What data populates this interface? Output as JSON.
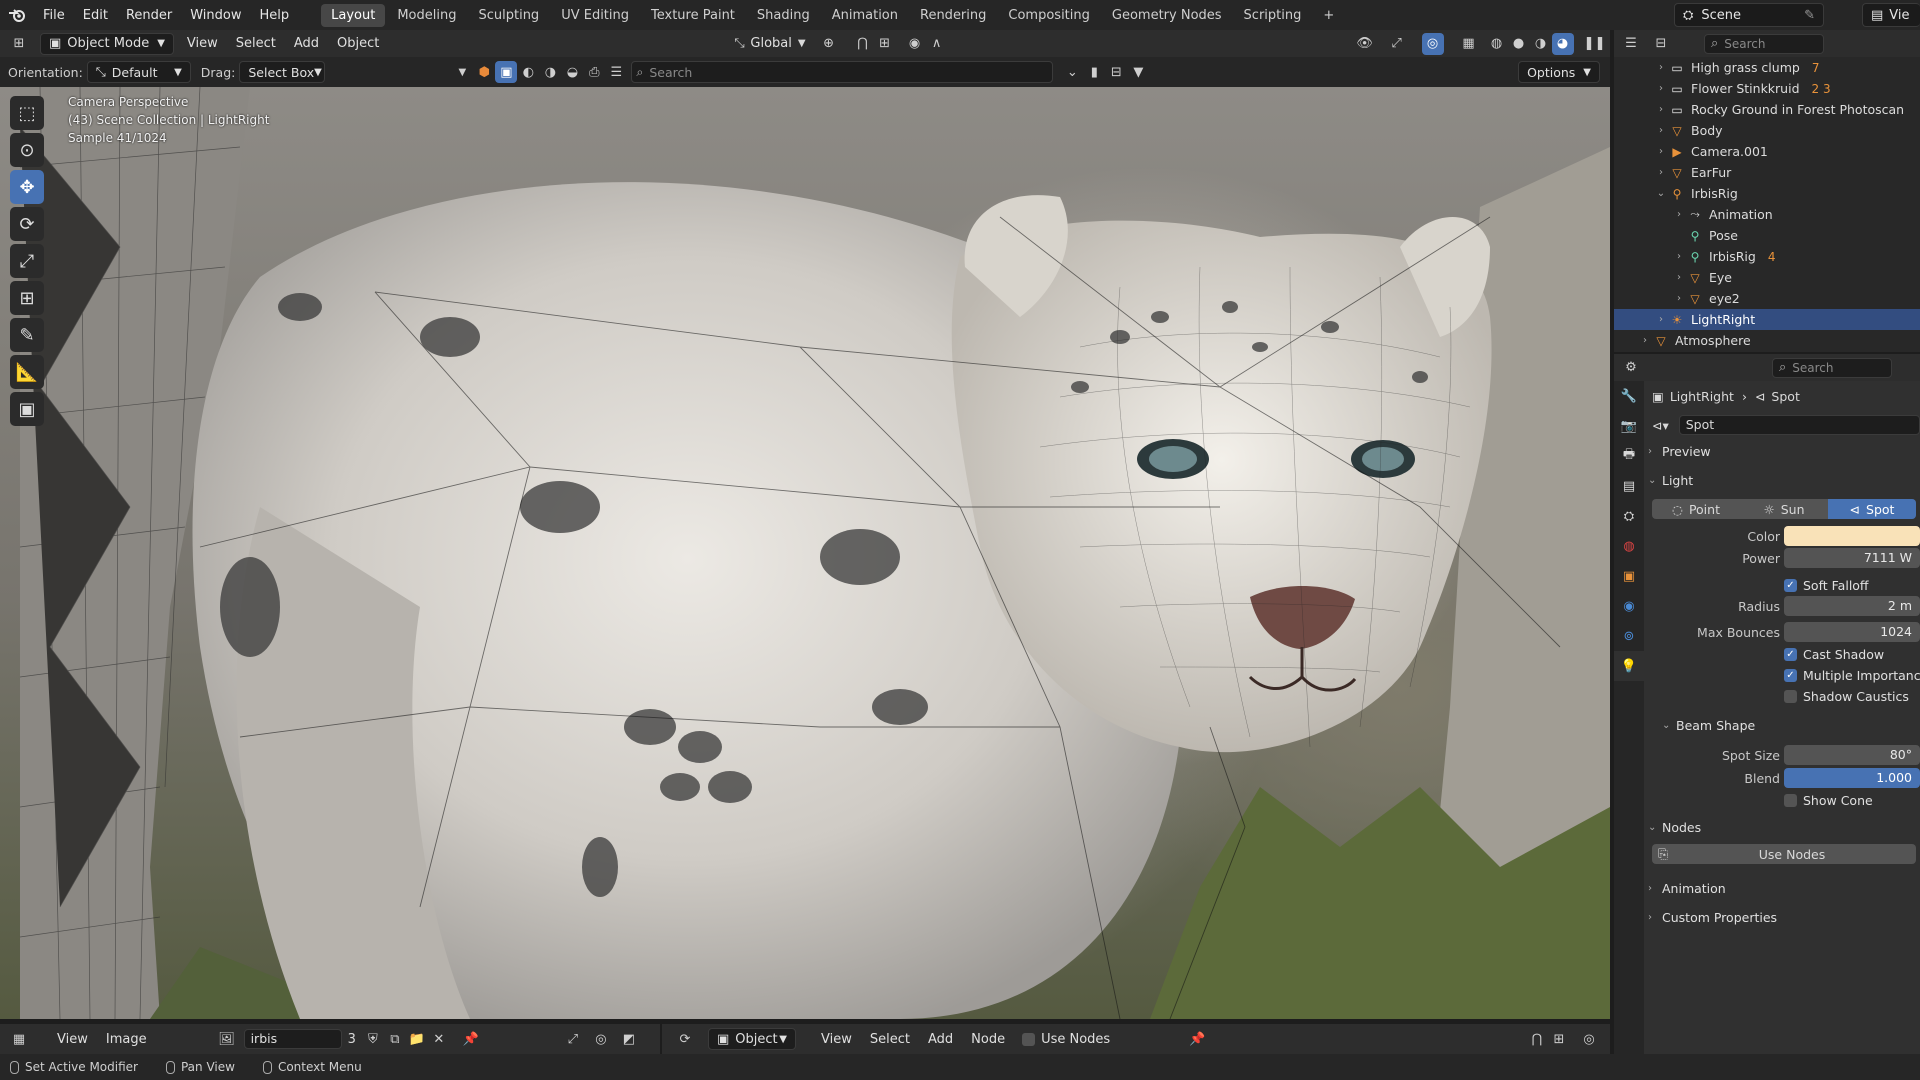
{
  "topbar": {
    "menus": [
      "File",
      "Edit",
      "Render",
      "Window",
      "Help"
    ],
    "workspaces": [
      "Layout",
      "Modeling",
      "Sculpting",
      "UV Editing",
      "Texture Paint",
      "Shading",
      "Animation",
      "Rendering",
      "Compositing",
      "Geometry Nodes",
      "Scripting"
    ],
    "active_workspace": "Layout",
    "add_tab": "+",
    "scene_name": "Scene",
    "viewlayer_name": "Vie"
  },
  "viewport_header": {
    "mode": "Object Mode",
    "menus": [
      "View",
      "Select",
      "Add",
      "Object"
    ],
    "transform_orientation": "Global"
  },
  "tool_options": {
    "orientation_label": "Orientation:",
    "orientation_value": "Default",
    "drag_label": "Drag:",
    "drag_value": "Select Box",
    "search_placeholder": "Search",
    "options_label": "Options"
  },
  "viewport_overlay": {
    "line1": "Camera Perspective",
    "line2": "(43) Scene Collection | LightRight",
    "line3": "Sample 41/1024"
  },
  "outliner": {
    "search_placeholder": "Search",
    "rows": [
      {
        "label": "High grass clump",
        "icon": "collection-icon",
        "indent": 0,
        "expander": "›",
        "extra": "7"
      },
      {
        "label": "Flower Stinkkruid",
        "icon": "collection-icon",
        "indent": 0,
        "expander": "›",
        "extra": "2 3"
      },
      {
        "label": "Rocky Ground in Forest Photoscan",
        "icon": "collection-icon",
        "indent": 0,
        "expander": "›",
        "extra": ""
      },
      {
        "label": "Body",
        "icon": "mesh-icon",
        "indent": 0,
        "expander": "›",
        "extra": ""
      },
      {
        "label": "Camera.001",
        "icon": "camera-icon",
        "indent": 0,
        "expander": "›",
        "extra": ""
      },
      {
        "label": "EarFur",
        "icon": "mesh-icon",
        "indent": 0,
        "expander": "›",
        "extra": ""
      },
      {
        "label": "IrbisRig",
        "icon": "armature-icon",
        "indent": 0,
        "expander": "⌄",
        "extra": ""
      },
      {
        "label": "Animation",
        "icon": "action-icon",
        "indent": 1,
        "expander": "›",
        "extra": ""
      },
      {
        "label": "Pose",
        "icon": "pose-icon",
        "indent": 1,
        "expander": "",
        "extra": ""
      },
      {
        "label": "IrbisRig",
        "icon": "armature-data-icon",
        "indent": 1,
        "expander": "›",
        "extra": "4"
      },
      {
        "label": "Eye",
        "icon": "mesh-icon",
        "indent": 1,
        "expander": "›",
        "extra": ""
      },
      {
        "label": "eye2",
        "icon": "mesh-icon",
        "indent": 1,
        "expander": "›",
        "extra": ""
      },
      {
        "label": "LightRight",
        "icon": "light-icon",
        "indent": 0,
        "expander": "›",
        "extra": "",
        "selected": true
      },
      {
        "label": "Atmosphere",
        "icon": "mesh-icon",
        "indent": -1,
        "expander": "›",
        "extra": ""
      }
    ]
  },
  "properties": {
    "search_placeholder": "Search",
    "breadcrumb_object": "LightRight",
    "breadcrumb_data": "Spot",
    "data_name": "Spot",
    "sections": {
      "preview": "Preview",
      "light": "Light",
      "beam_shape": "Beam Shape",
      "nodes": "Nodes",
      "animation": "Animation",
      "custom_properties": "Custom Properties"
    },
    "light_types": [
      "Point",
      "Sun",
      "Spot"
    ],
    "active_light_type": "Spot",
    "color_label": "Color",
    "color_value": "#f9e2b8",
    "power_label": "Power",
    "power_value": "7111 W",
    "soft_falloff": "Soft Falloff",
    "radius_label": "Radius",
    "radius_value": "2 m",
    "max_bounces_label": "Max Bounces",
    "max_bounces_value": "1024",
    "cast_shadow": "Cast Shadow",
    "multiple_importance": "Multiple Importanc",
    "shadow_caustics": "Shadow Caustics",
    "spot_size_label": "Spot Size",
    "spot_size_value": "80°",
    "blend_label": "Blend",
    "blend_value": "1.000",
    "show_cone": "Show Cone",
    "use_nodes_button": "Use Nodes"
  },
  "image_editor_header": {
    "menus": [
      "View",
      "Image"
    ],
    "image_name": "irbis",
    "user_count": "3"
  },
  "node_editor_header": {
    "object_type": "Object",
    "menus": [
      "View",
      "Select",
      "Add",
      "Node"
    ],
    "use_nodes": "Use Nodes"
  },
  "statusbar": {
    "left_click": "Set Active Modifier",
    "middle_click": "Pan View",
    "right_click": "Context Menu"
  },
  "colors": {
    "accent": "#4772b3",
    "selected_row": "#334d80",
    "light_orange": "#e8923a",
    "mesh_green": "#6bd66b"
  }
}
